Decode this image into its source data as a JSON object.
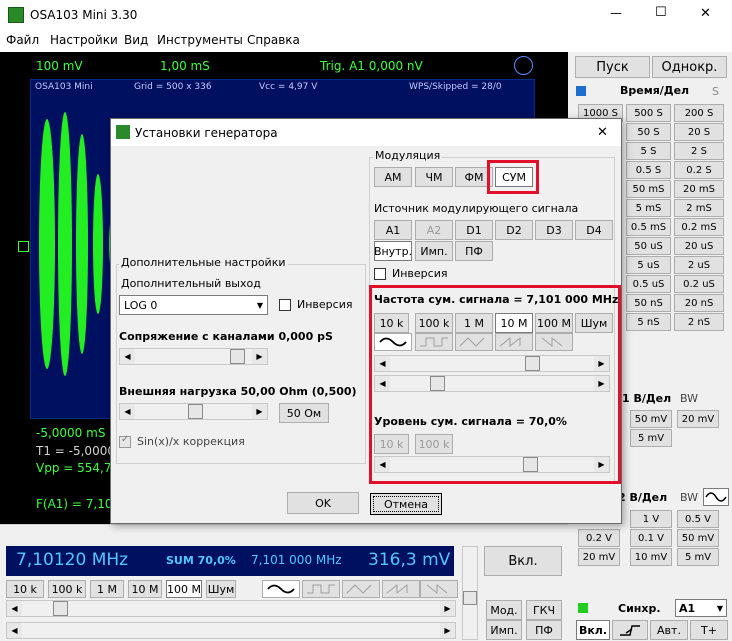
{
  "window": {
    "title": "OSA103 Mini 3.30",
    "min": "—",
    "max": "☐",
    "close": "✕"
  },
  "menu": [
    "Файл",
    "Настройки",
    "Вид",
    "Инструменты",
    "Справка"
  ],
  "scope": {
    "ch_scale": "100 mV",
    "time_scale": "1,00 mS",
    "trig": "Trig. A1  0,000 nV",
    "app": "OSA103 Mini",
    "grid": "Grid = 500 x 336",
    "vcc": "Vcc = 4,97 V",
    "wps": "WPS/Skipped = 28/0",
    "time_left": "-5,0000 mS",
    "t1": "T1 = -5,0000",
    "vpp": "Vpp = 554,7",
    "freq": "F(A1) = 7,10"
  },
  "right": {
    "start": "Пуск",
    "single": "Однокр.",
    "time_div": "Время/Дел",
    "s": "S",
    "time_buttons": [
      [
        "1000 S",
        "500 S",
        "200 S"
      ],
      [
        "",
        "50 S",
        "20 S"
      ],
      [
        "",
        "5 S",
        "2 S"
      ],
      [
        "",
        "0.5 S",
        "0.2 S"
      ],
      [
        "",
        "50 mS",
        "20 mS"
      ],
      [
        "",
        "5 mS",
        "2 mS"
      ],
      [
        "",
        "0.5 mS",
        "0.2 mS"
      ],
      [
        "",
        "50 uS",
        "20 uS"
      ],
      [
        "",
        "5 uS",
        "2 uS"
      ],
      [
        "",
        "0.5 uS",
        "0.2 uS"
      ],
      [
        "",
        "50 nS",
        "20 nS"
      ],
      [
        "",
        "5 nS",
        "2 nS"
      ]
    ],
    "v1": "1 В/Дел",
    "bw": "BW",
    "v1_buttons": [
      "50 mV",
      "20 mV",
      "5 mV"
    ],
    "v2": "2 В/Дел",
    "v2_buttons": [
      [
        "",
        "1 V",
        "0.5 V"
      ],
      [
        "0.2 V",
        "0.1 V",
        "50 mV"
      ],
      [
        "20 mV",
        "10 mV",
        "5 mV"
      ]
    ],
    "sync": "Синхр.",
    "sync_ch": "A1",
    "vkl": "Вкл.",
    "avt": "Авт.",
    "tplus": "T+"
  },
  "dialog": {
    "title": "Установки генератора",
    "close": "✕",
    "modulation": "Модуляция",
    "mod_buttons": [
      "AM",
      "ЧМ",
      "ФМ",
      "СУМ"
    ],
    "source": "Источник модулирующего сигнала",
    "source_buttons": [
      "A1",
      "A2",
      "D1",
      "D2",
      "D3",
      "D4"
    ],
    "src2": [
      "Внутр.",
      "Имп.",
      "ПФ"
    ],
    "inversion": "Инверсия",
    "freq_label": "Частота сум. сигнала = 7,101 000 MHz",
    "freq_buttons": [
      "10 k",
      "100 k",
      "1 M",
      "10 M",
      "100 M",
      "Шум"
    ],
    "level_label": "Уровень сум. сигнала = 70,0%",
    "level_buttons": [
      "10 k",
      "100 k"
    ],
    "extra": "Дополнительные настройки",
    "extra_out": "Дополнительный выход",
    "extra_select": "LOG 0",
    "extra_inv": "Инверсия",
    "coupling": "Сопряжение с каналами 0,000 pS",
    "load": "Внешняя нагрузка 50,00 Ohm  (0,500)",
    "load_btn": "50 Ом",
    "sinc": "Sin(x)/x коррекция",
    "ok": "OK",
    "cancel": "Отмена"
  },
  "gen": {
    "freq": "7,10120 MHz",
    "sum": "SUM 70,0%",
    "sum_freq": "7,101 000 MHz",
    "amp": "316,3 mV",
    "vkl": "Вкл.",
    "buttons": [
      "10 k",
      "100 k",
      "1 M",
      "10 M",
      "100 M",
      "Шум"
    ],
    "mod": "Мод.",
    "gkch": "ГКЧ",
    "imp": "Имп.",
    "pf": "ПФ"
  }
}
